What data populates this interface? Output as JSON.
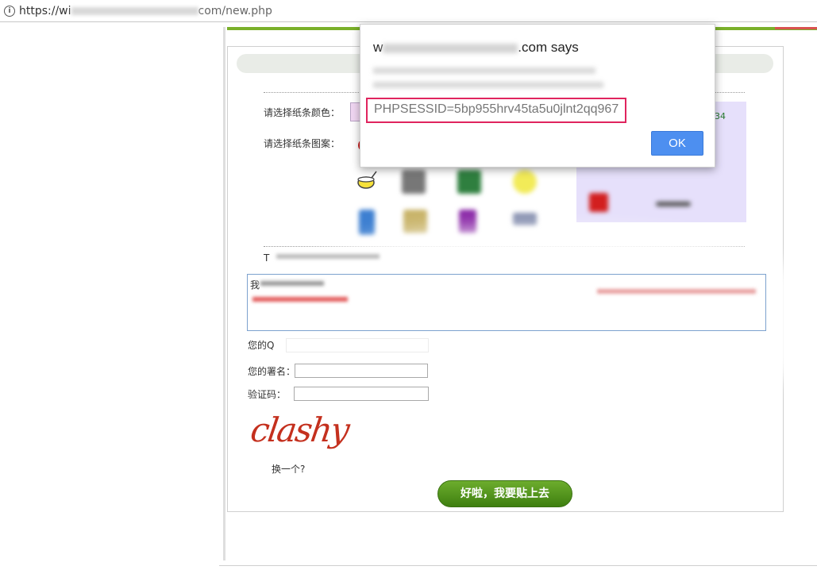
{
  "browser": {
    "url_prefix": "https://wi",
    "url_suffix": "com/new.php",
    "info_glyph": "i"
  },
  "form": {
    "color_label": "请选择纸条颜色：",
    "pattern_label": "请选择纸条图案：",
    "color_count_fragment": "34",
    "content_row_prefix": "我",
    "qq_label": "您的Q",
    "signature_label": "您的署名：",
    "captcha_label": "验证码：",
    "captcha_text": "clashy",
    "refresh_label": "换一个?",
    "submit_label": "好啦，我要贴上去",
    "row_prefix_t": "T"
  },
  "dialog": {
    "title_prefix": "w",
    "title_suffix": ".com says",
    "message": "PHPSESSID=5bp955hrv45ta5u0jlnt2qq967",
    "ok_label": "OK",
    "highlight_color": "#e0245e",
    "ok_color": "#4d8ff0"
  },
  "patterns": [
    {
      "name": "bowl-icon",
      "color": "#f0dc2a"
    },
    {
      "name": "bag-icon",
      "color": "#6f6f6f"
    },
    {
      "name": "box-icon",
      "color": "#2f7f3f"
    },
    {
      "name": "star-icon",
      "color": "#f5ec5a"
    },
    {
      "name": "bottle-icon",
      "color": "#3d7fd1"
    },
    {
      "name": "basket-icon",
      "color": "#c9b46a"
    },
    {
      "name": "ribbon-icon",
      "color": "#8b2aa8"
    },
    {
      "name": "cloud-icon",
      "color": "#8a93b2"
    },
    {
      "name": "red-square-icon",
      "color": "#d21f1f"
    },
    {
      "name": "dark-line-icon",
      "color": "#555555"
    }
  ],
  "colors": {
    "accent_green": "#7ab02a",
    "button_green": "#4f9220",
    "swatch_pink": "#f1d7f2",
    "area_purple": "#e6e0fb"
  }
}
